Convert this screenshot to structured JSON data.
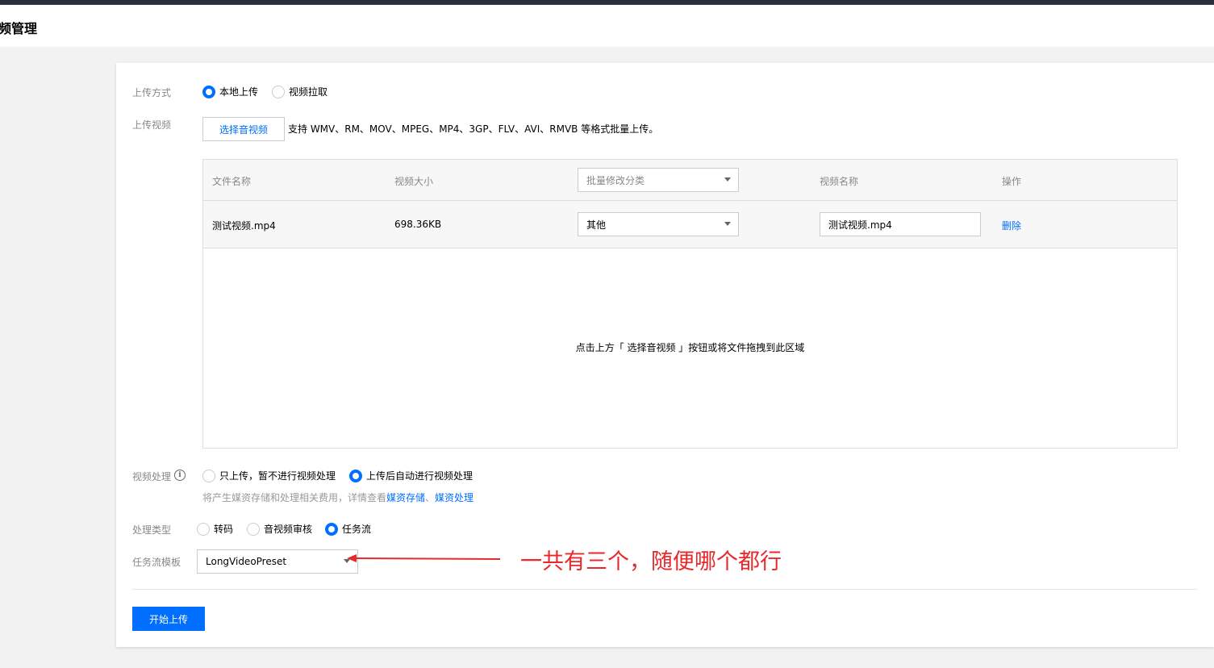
{
  "header": {
    "title": "频管理"
  },
  "upload_method": {
    "label": "上传方式",
    "options": [
      {
        "label": "本地上传",
        "checked": true
      },
      {
        "label": "视频拉取",
        "checked": false
      }
    ]
  },
  "upload_video": {
    "label": "上传视频",
    "button_label": "选择音视频",
    "hint": "支持 WMV、RM、MOV、MPEG、MP4、3GP、FLV、AVI、RMVB 等格式批量上传。"
  },
  "table": {
    "headers": {
      "file_name": "文件名称",
      "size": "视频大小",
      "batch_category": "批量修改分类",
      "video_name": "视频名称",
      "actions": "操作"
    },
    "rows": [
      {
        "file_name": "测试视频.mp4",
        "size": "698.36KB",
        "category": "其他",
        "video_name": "测试视频.mp4",
        "action": "删除"
      }
    ],
    "empty_hint": "点击上方「 选择音视频 」按钮或将文件拖拽到此区域"
  },
  "video_processing": {
    "label": "视频处理",
    "options": [
      {
        "label": "只上传，暂不进行视频处理",
        "checked": false
      },
      {
        "label": "上传后自动进行视频处理",
        "checked": true
      }
    ],
    "desc_prefix": "将产生媒资存储和处理相关费用，详情查看",
    "link1": "媒资存储",
    "separator": "、",
    "link2": "媒资处理"
  },
  "process_type": {
    "label": "处理类型",
    "options": [
      {
        "label": "转码",
        "checked": false
      },
      {
        "label": "音视频审核",
        "checked": false
      },
      {
        "label": "任务流",
        "checked": true
      }
    ]
  },
  "workflow_template": {
    "label": "任务流模板",
    "value": "LongVideoPreset"
  },
  "submit_label": "开始上传",
  "annotation": {
    "text": "一共有三个，随便哪个都行",
    "color": "#e8282b"
  },
  "colors": {
    "accent": "#006eff",
    "topbar": "#2b2f3a"
  }
}
